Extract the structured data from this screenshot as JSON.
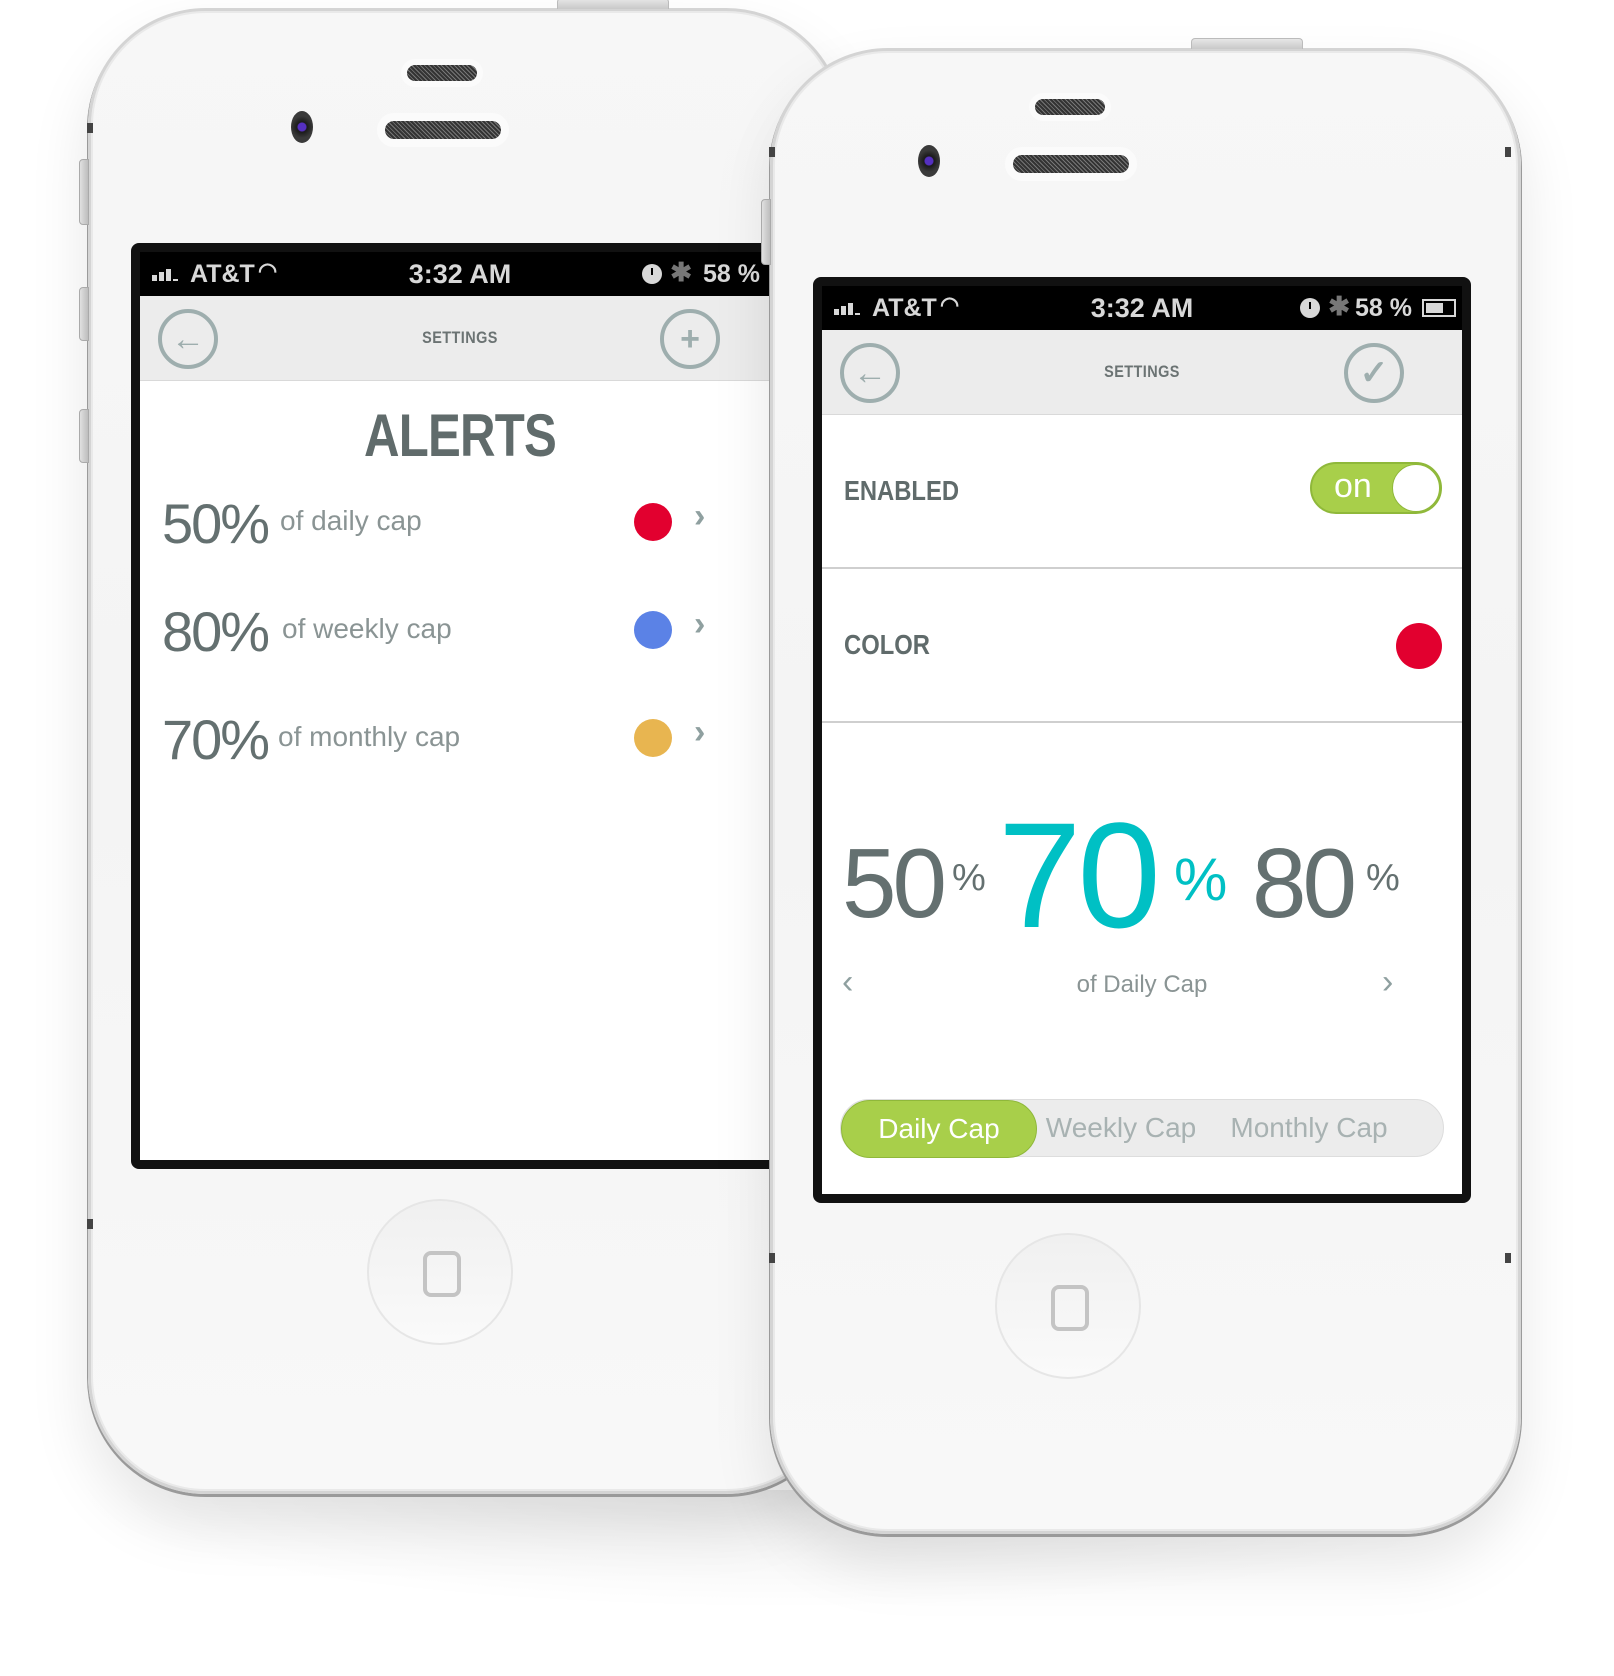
{
  "status_bar": {
    "carrier": "AT&T",
    "time": "3:32 AM",
    "battery": "58 %",
    "battery_level": 0.58,
    "icons": [
      "signal-icon",
      "wifi-icon",
      "clock-icon",
      "bluetooth-icon",
      "battery-icon"
    ]
  },
  "left_screen": {
    "nav": {
      "title": "SETTINGS",
      "back_icon": "arrow-left-circle-icon",
      "add_icon": "plus-circle-icon"
    },
    "heading": "ALERTS",
    "alerts": [
      {
        "percent": "50%",
        "description": "of daily cap",
        "color": "#e2002f"
      },
      {
        "percent": "80%",
        "description": "of weekly cap",
        "color": "#5b82e6"
      },
      {
        "percent": "70%",
        "description": "of monthly cap",
        "color": "#e8b550"
      }
    ],
    "chevron": "›"
  },
  "right_screen": {
    "nav": {
      "title": "SETTINGS",
      "back_icon": "arrow-left-circle-icon",
      "confirm_icon": "checkmark-circle-icon"
    },
    "enabled": {
      "label": "ENABLED",
      "toggle_text": "on",
      "toggle_state": true,
      "accent": "#a8cf4a"
    },
    "color": {
      "label": "COLOR",
      "value": "#e2002f"
    },
    "picker": {
      "options": [
        "50",
        "70",
        "80"
      ],
      "selected": "70",
      "percent_sign": "%",
      "accent": "#00c0c4",
      "cap_label": "of Daily Cap",
      "prev": "‹",
      "next": "›"
    },
    "segments": [
      {
        "label": "Daily Cap",
        "active": true
      },
      {
        "label": "Weekly Cap",
        "active": false
      },
      {
        "label": "Monthly Cap",
        "active": false
      }
    ]
  }
}
